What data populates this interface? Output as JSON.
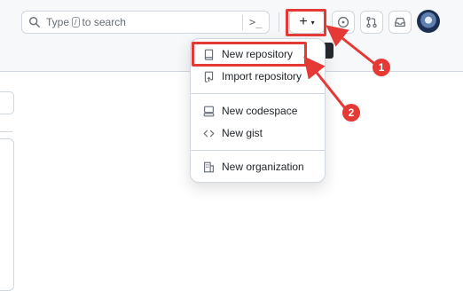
{
  "header": {
    "search": {
      "prefix": "Type",
      "key": "/",
      "suffix": "to search",
      "command_glyph": ">_"
    },
    "create_button": {
      "plus": "+",
      "caret": "▾"
    },
    "icons": [
      "search-icon",
      "command-palette-icon",
      "plus-icon",
      "caret-down-icon",
      "issues-icon",
      "pull-requests-icon",
      "inbox-icon"
    ]
  },
  "create_menu": {
    "items": [
      {
        "label": "New repository",
        "icon": "repo-icon"
      },
      {
        "label": "Import repository",
        "icon": "repo-push-icon"
      },
      {
        "label": "New codespace",
        "icon": "codespaces-icon"
      },
      {
        "label": "New gist",
        "icon": "code-icon"
      },
      {
        "label": "New organization",
        "icon": "organization-icon"
      }
    ]
  },
  "annotations": {
    "step1": "1",
    "step2": "2",
    "color": "#e53935"
  }
}
